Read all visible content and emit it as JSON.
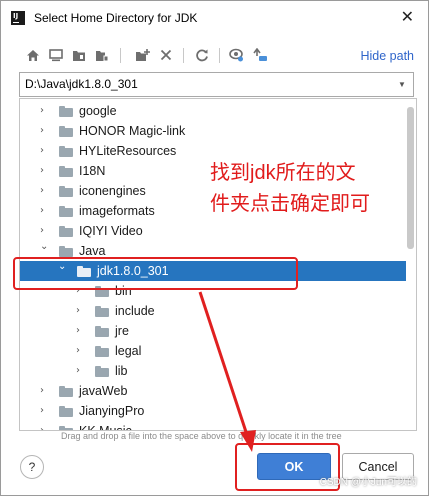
{
  "window": {
    "title": "Select Home Directory for JDK",
    "app_icon_text": "IJ"
  },
  "toolbar": {
    "icons": [
      "home-icon",
      "desktop-icon",
      "project-folder-icon",
      "module-folder-icon",
      "new-folder-icon",
      "delete-icon",
      "refresh-icon",
      "show-hidden-icon",
      "bookmark-icon"
    ],
    "hide_path_label": "Hide path"
  },
  "path": {
    "value": "D:\\Java\\jdk1.8.0_301"
  },
  "tree": {
    "items": [
      {
        "name": "google",
        "expanded": false,
        "selected": false
      },
      {
        "name": "HONOR Magic-link",
        "expanded": false,
        "selected": false
      },
      {
        "name": "HYLiteResources",
        "expanded": false,
        "selected": false
      },
      {
        "name": "I18N",
        "expanded": false,
        "selected": false
      },
      {
        "name": "iconengines",
        "expanded": false,
        "selected": false
      },
      {
        "name": "imageformats",
        "expanded": false,
        "selected": false
      },
      {
        "name": "IQIYI Video",
        "expanded": false,
        "selected": false
      },
      {
        "name": "Java",
        "expanded": true,
        "selected": false
      },
      {
        "name": "jdk1.8.0_301",
        "expanded": true,
        "selected": true
      },
      {
        "name": "bin",
        "expanded": false,
        "selected": false
      },
      {
        "name": "include",
        "expanded": false,
        "selected": false
      },
      {
        "name": "jre",
        "expanded": false,
        "selected": false
      },
      {
        "name": "legal",
        "expanded": false,
        "selected": false
      },
      {
        "name": "lib",
        "expanded": false,
        "selected": false
      },
      {
        "name": "javaWeb",
        "expanded": false,
        "selected": false
      },
      {
        "name": "JianyingPro",
        "expanded": false,
        "selected": false
      },
      {
        "name": "KK Music",
        "expanded": false,
        "selected": false
      }
    ]
  },
  "hint": "Drag and drop a file into the space above to quickly locate it in the tree",
  "buttons": {
    "help": "?",
    "ok": "OK",
    "cancel": "Cancel"
  },
  "annotation": {
    "line1": "找到jdk所在的文",
    "line2": "件夹点击确定即可",
    "color": "#e11b1b"
  },
  "watermark": "CSDN @小Jun可以的",
  "colors": {
    "selection": "#2675bf",
    "ok_button": "#3f7fd6",
    "link": "#2f65ca",
    "highlight": "#e02020"
  }
}
